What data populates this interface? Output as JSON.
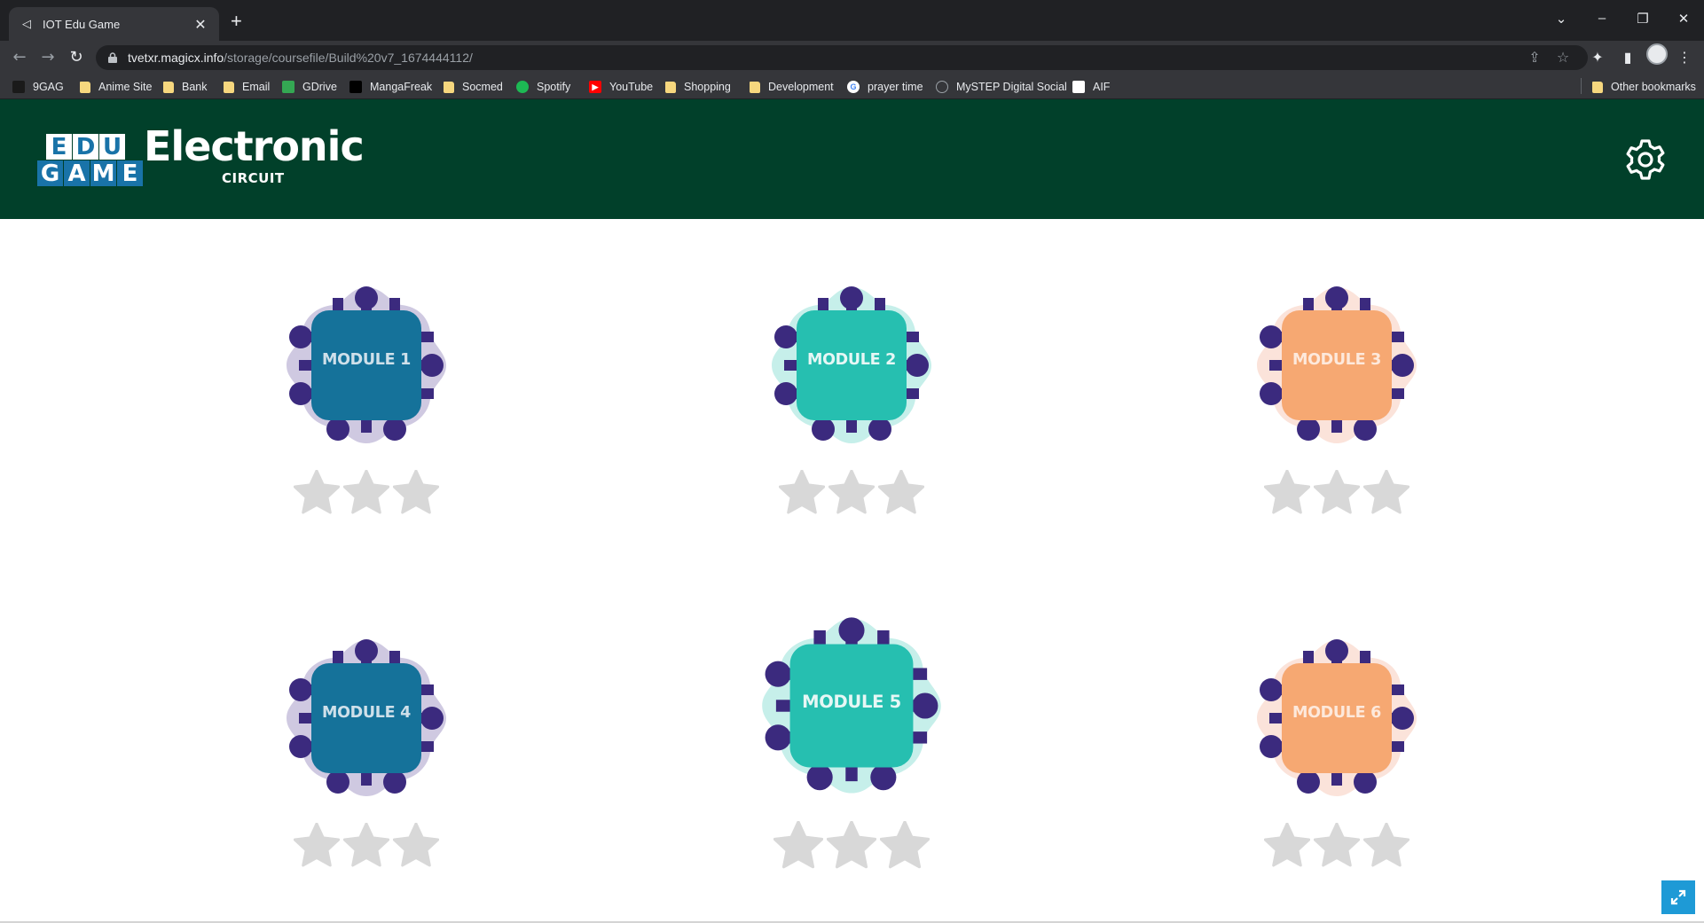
{
  "browser": {
    "tab_title": "IOT Edu Game",
    "tab_close": "✕",
    "new_tab": "+",
    "url_host": "tvetxr.magicx.info",
    "url_path": "/storage/coursefile/Build%20v7_1674444112/",
    "bookmarks": [
      {
        "label": "9GAG",
        "icon": "9gag-icon",
        "color": "#1a1a1a"
      },
      {
        "label": "Anime Site",
        "icon": "folder-icon"
      },
      {
        "label": "Bank",
        "icon": "folder-icon"
      },
      {
        "label": "Email",
        "icon": "folder-icon"
      },
      {
        "label": "GDrive",
        "icon": "gdrive-icon",
        "color": "#34a853"
      },
      {
        "label": "MangaFreak",
        "icon": "mangafreak-icon",
        "color": "#000000"
      },
      {
        "label": "Socmed",
        "icon": "folder-icon"
      },
      {
        "label": "Spotify",
        "icon": "spotify-icon",
        "color": "#1db954"
      },
      {
        "label": "YouTube",
        "icon": "youtube-icon",
        "color": "#ff0000"
      },
      {
        "label": "Shopping",
        "icon": "folder-icon"
      },
      {
        "label": "Development",
        "icon": "folder-icon"
      },
      {
        "label": "prayer time",
        "icon": "google-icon",
        "color": "#ffffff"
      },
      {
        "label": "MySTEP Digital Social",
        "icon": "mystep-icon",
        "color": "#5f6368"
      },
      {
        "label": "AIF",
        "icon": "aif-icon",
        "color": "#ffffff"
      }
    ],
    "other_bookmarks": "Other bookmarks"
  },
  "game": {
    "logo_top": [
      "E",
      "D",
      "U"
    ],
    "logo_bottom": [
      "G",
      "A",
      "M",
      "E"
    ],
    "title": "Electronic",
    "subtitle": "CIRCUIT",
    "colors": {
      "header": "#01402a",
      "pin": "#3b2a7e",
      "star_empty": "#d8d8d8"
    },
    "modules": [
      {
        "label": "MODULE 1",
        "chip": "#15729a",
        "halo": "#cfc9e1",
        "text": "#cfe0ea",
        "stars_earned": 0,
        "stars_total": 3
      },
      {
        "label": "MODULE 2",
        "chip": "#26bfb0",
        "halo": "#c6efea",
        "text": "#e6f7f5",
        "stars_earned": 0,
        "stars_total": 3
      },
      {
        "label": "MODULE 3",
        "chip": "#f6a872",
        "halo": "#fbe3da",
        "text": "#fde9dc",
        "stars_earned": 0,
        "stars_total": 3
      },
      {
        "label": "MODULE 4",
        "chip": "#15729a",
        "halo": "#cfc9e1",
        "text": "#cfe0ea",
        "stars_earned": 0,
        "stars_total": 3
      },
      {
        "label": "MODULE 5",
        "chip": "#26bfb0",
        "halo": "#c6efea",
        "text": "#e6f7f5",
        "stars_earned": 0,
        "stars_total": 3
      },
      {
        "label": "MODULE 6",
        "chip": "#f6a872",
        "halo": "#fbe3da",
        "text": "#fde9dc",
        "stars_earned": 0,
        "stars_total": 3
      }
    ]
  }
}
